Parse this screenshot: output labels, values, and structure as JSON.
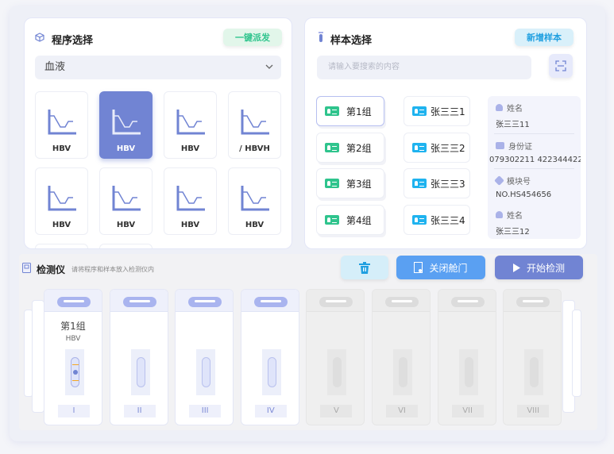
{
  "program": {
    "title": "程序选择",
    "dispatch_button": "一键派发",
    "sample_type": "血液",
    "cards": [
      {
        "label": "HBV",
        "selected": false
      },
      {
        "label": "HBV",
        "selected": true
      },
      {
        "label": "HBV",
        "selected": false
      },
      {
        "label": "/  HBVH",
        "selected": false
      },
      {
        "label": "HBV",
        "selected": false
      },
      {
        "label": "HBV",
        "selected": false
      },
      {
        "label": "HBV",
        "selected": false
      },
      {
        "label": "HBV",
        "selected": false
      }
    ]
  },
  "sample": {
    "title": "样本选择",
    "add_button": "新增样本",
    "search_placeholder": "请输入要搜索的内容",
    "groups": [
      "第1组",
      "第2组",
      "第3组",
      "第4组"
    ],
    "samples": [
      "张三三1",
      "张三三2",
      "张三三3",
      "张三三4"
    ],
    "info": {
      "name_label": "姓名",
      "name_value": "张三三11",
      "id_label": "身份证",
      "id_value": "079302211  422344422",
      "module_label": "模块号",
      "module_value": "NO.HS454656",
      "name2_label": "姓名",
      "name2_value": "张三三12"
    }
  },
  "detector": {
    "title": "检测仪",
    "hint": "请将程序和样本放入检测仪内",
    "close_door": "关闭舱门",
    "start": "开始检测",
    "slots": [
      {
        "num": "I",
        "group": "第1组",
        "program": "HBV",
        "active": true,
        "loaded": true
      },
      {
        "num": "II",
        "active": true
      },
      {
        "num": "III",
        "active": true
      },
      {
        "num": "IV",
        "active": true
      },
      {
        "num": "V",
        "active": false
      },
      {
        "num": "VI",
        "active": false
      },
      {
        "num": "VII",
        "active": false
      },
      {
        "num": "VIII",
        "active": false
      }
    ]
  },
  "colors": {
    "accent": "#7184d3",
    "green": "#2fc48d",
    "blue": "#1fb3ef",
    "door_button": "#5aa0f2"
  }
}
